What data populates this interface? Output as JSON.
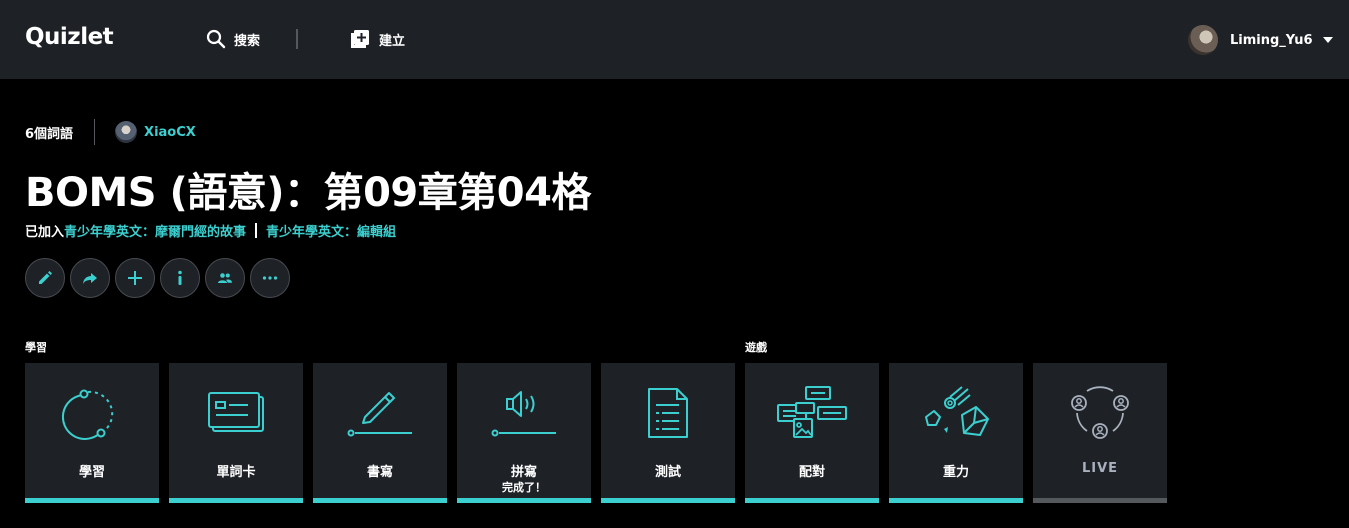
{
  "nav": {
    "logo": "Quizlet",
    "search_label": "搜索",
    "create_label": "建立",
    "username": "Liming_Yu6"
  },
  "set": {
    "term_count": "6個詞語",
    "author": "XiaoCX",
    "title": "BOMS (語意)：第09章第04格",
    "added_prefix": "已加入",
    "folders": [
      "青少年學英文：摩爾門經的故事",
      "青少年學英文：編輯組"
    ]
  },
  "sections": {
    "study": "學習",
    "games": "遊戲"
  },
  "modes": [
    {
      "label": "學習",
      "icon": "learn-icon"
    },
    {
      "label": "單詞卡",
      "icon": "flashcards-icon"
    },
    {
      "label": "書寫",
      "icon": "write-icon"
    },
    {
      "label": "拼寫",
      "sub": "完成了！",
      "icon": "spell-icon"
    },
    {
      "label": "測試",
      "icon": "test-icon"
    },
    {
      "label": "配對",
      "icon": "match-icon"
    },
    {
      "label": "重力",
      "icon": "gravity-icon"
    },
    {
      "label": "LIVE",
      "icon": "live-icon"
    }
  ],
  "colors": {
    "accent": "#3ccfcf",
    "nav_bg": "#1e2227",
    "card_bg": "#1e2227",
    "page_bg": "#000000",
    "live_bar": "#55595e"
  }
}
